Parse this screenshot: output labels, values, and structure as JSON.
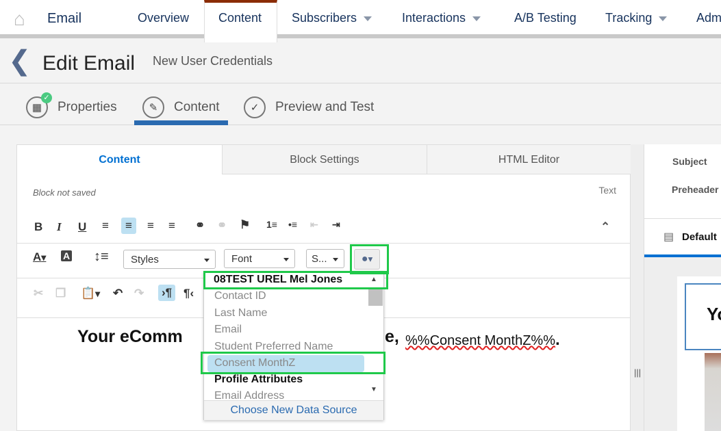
{
  "topnav": {
    "app_title": "Email",
    "items": [
      {
        "label": "Overview"
      },
      {
        "label": "Content",
        "active": true
      },
      {
        "label": "Subscribers",
        "dropdown": true
      },
      {
        "label": "Interactions",
        "dropdown": true
      },
      {
        "label": "A/B Testing"
      },
      {
        "label": "Tracking",
        "dropdown": true
      },
      {
        "label": "Adm"
      }
    ]
  },
  "header": {
    "title": "Edit Email",
    "subtitle": "New User Credentials"
  },
  "steps": [
    {
      "label": "Properties",
      "complete": true
    },
    {
      "label": "Content",
      "active": true
    },
    {
      "label": "Preview and Test"
    }
  ],
  "editor": {
    "tabs": [
      {
        "label": "Content",
        "active": true
      },
      {
        "label": "Block Settings"
      },
      {
        "label": "HTML Editor"
      }
    ],
    "status": "Block not saved",
    "block_type": "Text",
    "styles_label": "Styles",
    "font_label": "Font",
    "size_label": "S...",
    "content": {
      "part1": "Your eComm",
      "part2": "e,",
      "variable": "%%Consent MonthZ%%",
      "end": "."
    }
  },
  "dropdown": {
    "header": "08TEST UREL Mel Jones",
    "items": [
      "Contact ID",
      "Last Name",
      "Email",
      "Student Preferred Name",
      "Consent MonthZ"
    ],
    "selected": "Consent MonthZ",
    "section2": "Profile Attributes",
    "section2_items": [
      "Email Address"
    ],
    "footer": "Choose New Data Source"
  },
  "right": {
    "subject_label": "Subject",
    "preheader_label": "Preheader",
    "tab_label": "Default",
    "preview_text": "Yo"
  },
  "colors": {
    "accent": "#0070d2",
    "highlight": "#1fc94a",
    "nav_active_border": "#8b2c05",
    "selected_item": "#bde0f2"
  }
}
